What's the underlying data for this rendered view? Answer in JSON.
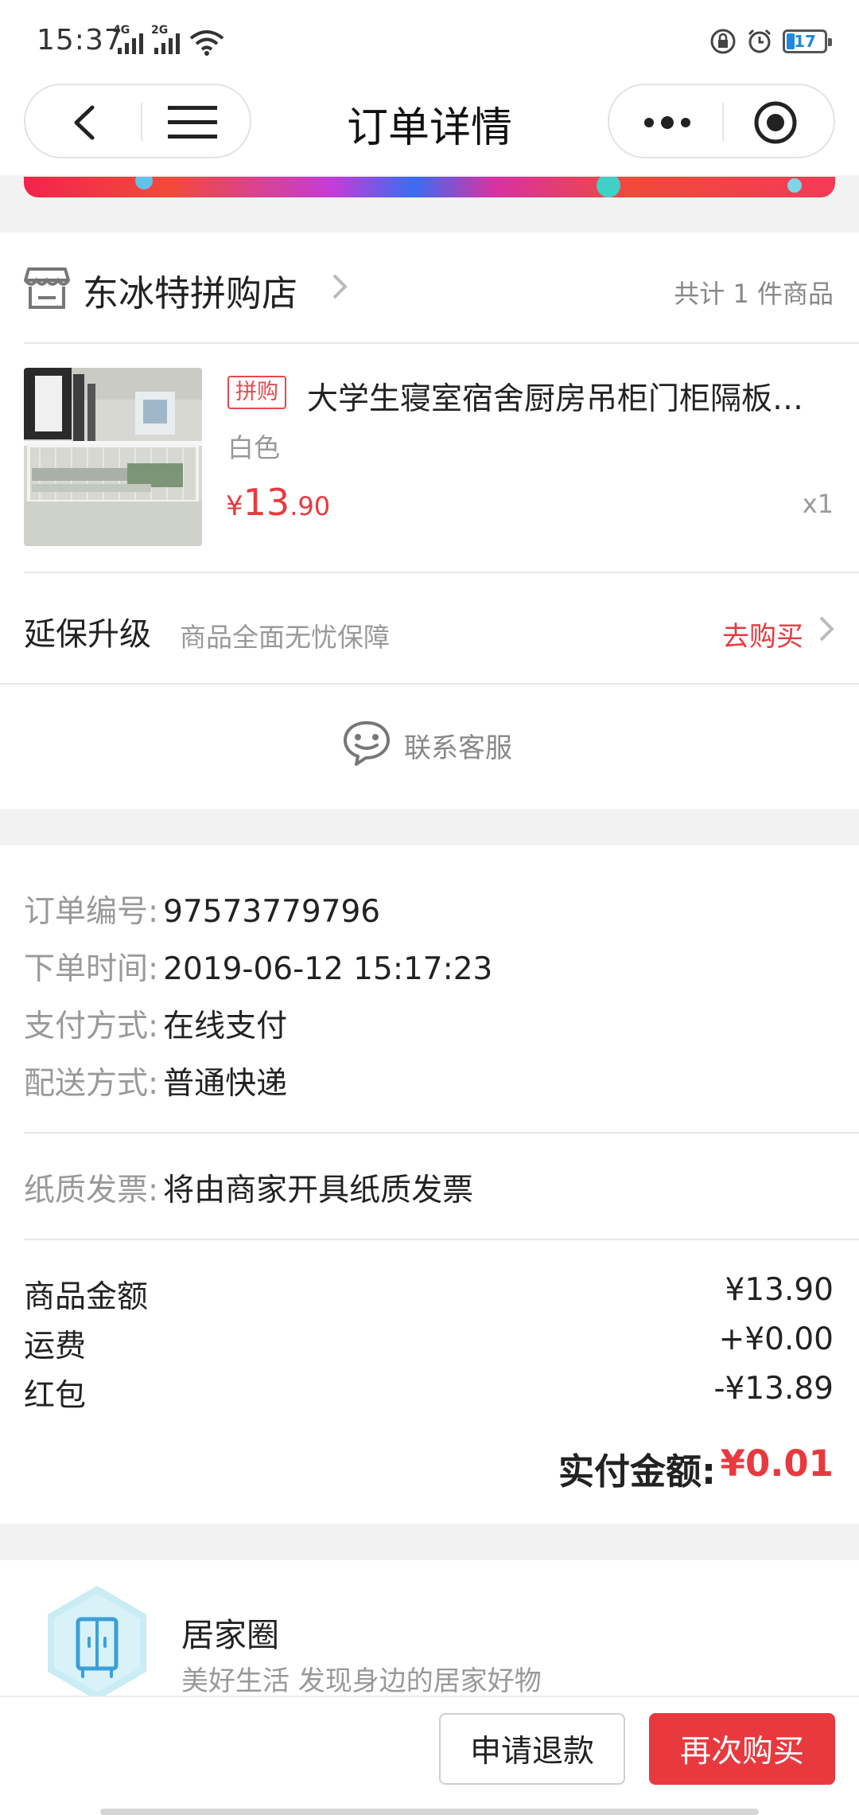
{
  "status_bar": {
    "time": "15:37",
    "network_1": "4G",
    "network_2": "2G",
    "battery_level": "17"
  },
  "header": {
    "title": "订单详情",
    "back_icon": "back-arrow-icon",
    "menu_icon": "hamburger-menu-icon",
    "more_icon": "more-dots-icon",
    "close_icon": "target-circle-icon"
  },
  "store": {
    "name": "东冰特拼购店",
    "item_count": "共计 1 件商品"
  },
  "product": {
    "badge": "拼购",
    "title": "大学生寝室宿舍厨房吊柜门柜隔板…",
    "variant": "白色",
    "price_symbol": "¥",
    "price_integer": "13",
    "price_decimal": ".90",
    "quantity": "x1"
  },
  "warranty": {
    "title": "延保升级",
    "description": "商品全面无忧保障",
    "action": "去购买"
  },
  "customer_service": {
    "label": "联系客服"
  },
  "order_info": {
    "order_number_label": "订单编号:",
    "order_number": "97573779796",
    "order_time_label": "下单时间:",
    "order_time": "2019-06-12 15:17:23",
    "payment_label": "支付方式:",
    "payment": "在线支付",
    "delivery_label": "配送方式:",
    "delivery": "普通快递",
    "invoice_label": "纸质发票:",
    "invoice": "将由商家开具纸质发票"
  },
  "fees": {
    "goods_label": "商品金额",
    "goods_value": "¥13.90",
    "shipping_label": "运费",
    "shipping_value": "+¥0.00",
    "redpacket_label": "红包",
    "redpacket_value": "-¥13.89",
    "paid_label": "实付金额:",
    "paid_value": "¥0.01"
  },
  "circle": {
    "title": "居家圈",
    "description": "美好生活 发现身边的居家好物"
  },
  "actions": {
    "refund": "申请退款",
    "rebuy": "再次购买"
  },
  "colors": {
    "accent_red": "#e8393f",
    "muted_gray": "#999999"
  }
}
